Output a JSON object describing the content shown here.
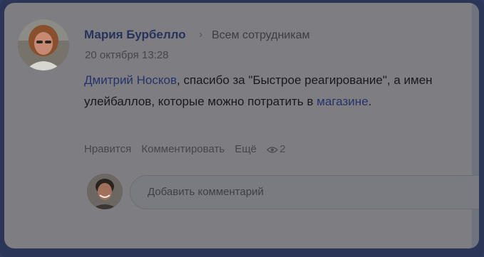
{
  "post": {
    "author": "Мария Бурбелло",
    "audience": "Всем сотрудникам",
    "timestamp": "20 октября 13:28",
    "text": {
      "mention": "Дмитрий Носков",
      "line1_rest": ", спасибо за \"Быстрое реагирование\", а имен",
      "line2_before_link": "улейбаллов, которые можно потратить в ",
      "link": "магазине",
      "line2_after_link": "."
    }
  },
  "actions": {
    "like": "Нравится",
    "comment": "Комментировать",
    "more": "Ещё",
    "views": "2"
  },
  "comment": {
    "placeholder": "Добавить комментарий"
  },
  "icons": {
    "chevron": "chevron-right-icon",
    "views": "eye-icon"
  }
}
